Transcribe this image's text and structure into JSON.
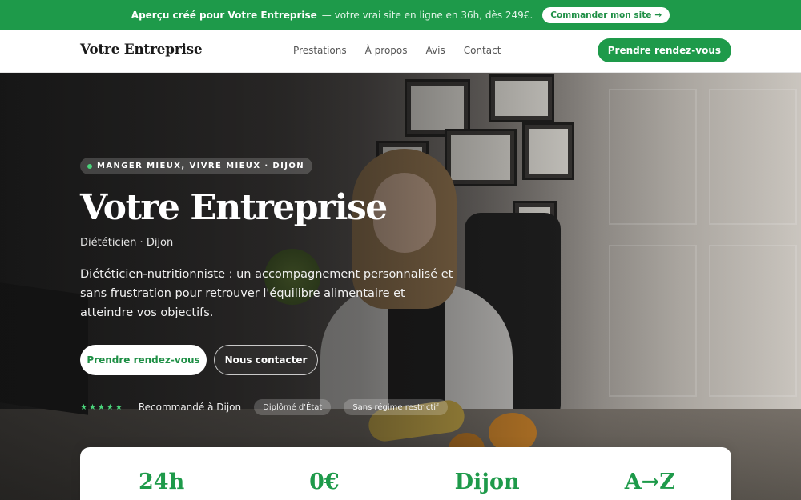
{
  "promo": {
    "lead": "Aperçu créé pour Votre Entreprise",
    "rest": " — votre vrai site en ligne en 36h, dès 249€.",
    "button": "Commander mon site",
    "button_arrow": "→"
  },
  "nav": {
    "brand": "Votre Entreprise",
    "links": [
      "Prestations",
      "À propos",
      "Avis",
      "Contact"
    ],
    "cta": "Prendre rendez-vous"
  },
  "hero": {
    "eyebrow": "MANGER MIEUX, VIVRE MIEUX · DIJON",
    "title": "Votre Entreprise",
    "subtitle": "Diététicien · Dijon",
    "description": "Diététicien-nutritionniste : un accompagnement personnalisé et sans frustration pour retrouver l'équilibre alimentaire et atteindre vos objectifs.",
    "primary_button": "Prendre rendez-vous",
    "secondary_button": "Nous contacter",
    "stars": "★★★★★",
    "rating_text": "Recommandé à Dijon",
    "chips": [
      "Diplômé d'État",
      "Sans régime restrictif"
    ]
  },
  "stats": [
    "24h",
    "0€",
    "Dijon",
    "A→Z"
  ],
  "colors": {
    "brand_green": "#1e9a4a",
    "accent_green": "#4ad37a"
  }
}
